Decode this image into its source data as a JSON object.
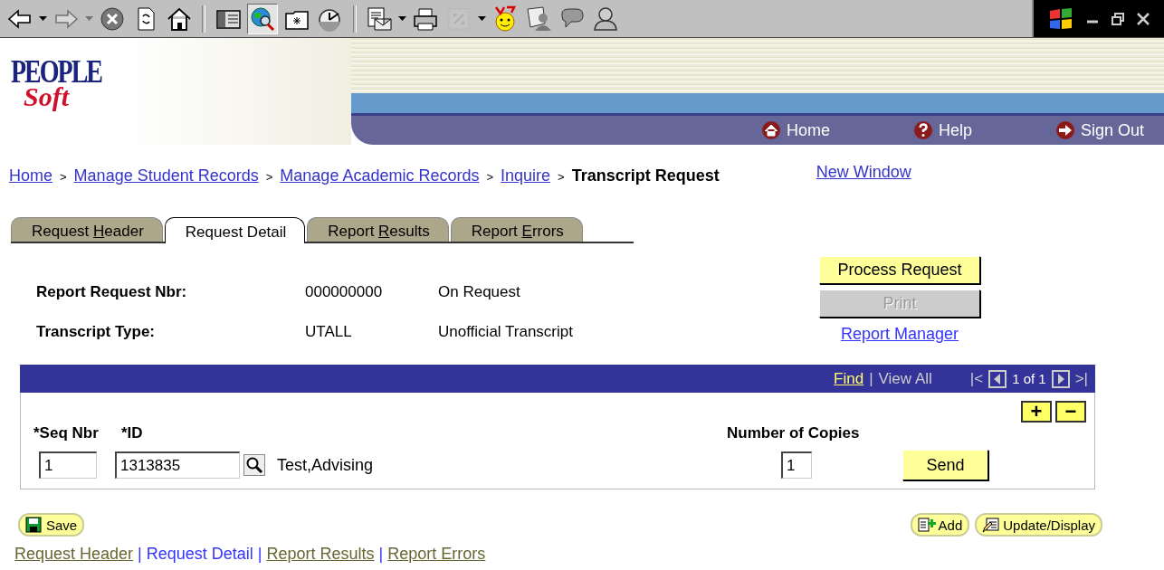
{
  "toolbar": [
    {
      "kind": "back",
      "disabled": false,
      "selected": false
    },
    {
      "kind": "dropdown",
      "disabled": false
    },
    {
      "kind": "forward",
      "disabled": true,
      "selected": false
    },
    {
      "kind": "dropdown",
      "disabled": true
    },
    {
      "kind": "stop",
      "disabled": false,
      "selected": false
    },
    {
      "kind": "refresh",
      "disabled": false,
      "selected": false
    },
    {
      "kind": "home",
      "disabled": false,
      "selected": false
    },
    {
      "kind": "separator"
    },
    {
      "kind": "panel",
      "disabled": false,
      "selected": false
    },
    {
      "kind": "search",
      "disabled": false,
      "selected": true
    },
    {
      "kind": "folder",
      "disabled": false,
      "selected": false
    },
    {
      "kind": "history",
      "disabled": false,
      "selected": false
    },
    {
      "kind": "separator"
    },
    {
      "kind": "mail",
      "disabled": false,
      "selected": false
    },
    {
      "kind": "dropdown",
      "disabled": false
    },
    {
      "kind": "print",
      "disabled": false,
      "selected": false
    },
    {
      "kind": "frame",
      "disabled": true,
      "selected": false
    },
    {
      "kind": "dropdown",
      "disabled": false
    },
    {
      "kind": "smiley",
      "disabled": false,
      "selected": false
    },
    {
      "kind": "people",
      "disabled": false,
      "selected": false
    },
    {
      "kind": "chat",
      "disabled": false,
      "selected": false
    },
    {
      "kind": "user",
      "disabled": false,
      "selected": false
    }
  ],
  "logo": {
    "top": "PEOPLE",
    "bottom": "Soft"
  },
  "header_nav": [
    {
      "kind": "home",
      "label": "Home"
    },
    {
      "kind": "help",
      "label": "Help"
    },
    {
      "kind": "signout",
      "label": "Sign Out"
    }
  ],
  "breadcrumb": [
    {
      "kind": "link",
      "text": "Home"
    },
    {
      "kind": "separator",
      "text": ">"
    },
    {
      "kind": "link",
      "text": "Manage Student Records"
    },
    {
      "kind": "separator",
      "text": ">"
    },
    {
      "kind": "link",
      "text": "Manage Academic Records"
    },
    {
      "kind": "separator",
      "text": ">"
    },
    {
      "kind": "link",
      "text": "Inquire"
    },
    {
      "kind": "separator",
      "text": ">"
    },
    {
      "kind": "current",
      "text": "Transcript Request"
    }
  ],
  "new_window": "New Window",
  "tabs": [
    {
      "parts": [
        "Request ",
        "H",
        "eader"
      ],
      "selected": false
    },
    {
      "parts": [
        "Request Detail"
      ],
      "selected": true
    },
    {
      "parts": [
        "Report ",
        "R",
        "esults"
      ],
      "selected": false
    },
    {
      "parts": [
        "Report ",
        "E",
        "rrors"
      ],
      "selected": false
    }
  ],
  "fields": [
    {
      "label": "Report Request Nbr:",
      "value": "000000000",
      "description": "On Request"
    },
    {
      "label": "Transcript Type:",
      "value": "UTALL",
      "description": "Unofficial Transcript"
    }
  ],
  "actions": [
    {
      "label": "Process Request",
      "disabled": false
    },
    {
      "label": "Print",
      "disabled": true
    }
  ],
  "report_manager": "Report Manager",
  "grid": {
    "find": "Find",
    "divider": "|",
    "view_all": "View All",
    "first": "|<",
    "counter": "1 of 1",
    "last": ">|",
    "add_row": "+",
    "delete_row": "−",
    "seq_label": "*Seq Nbr",
    "id_label": "*ID",
    "copies_label": "Number of Copies",
    "seq": "1",
    "id": "1313835",
    "name": "Test,Advising",
    "copies": "1",
    "send": "Send"
  },
  "page_buttons": [
    {
      "kind": "save",
      "label": "Save"
    },
    {
      "kind": "add",
      "label": "Add"
    },
    {
      "kind": "update",
      "label": "Update/Display"
    }
  ],
  "page_links": [
    {
      "kind": "link",
      "text": "Request Header",
      "selected": false
    },
    {
      "kind": "separator",
      "text": "|"
    },
    {
      "kind": "link",
      "text": "Request Detail",
      "selected": true
    },
    {
      "kind": "separator",
      "text": "|"
    },
    {
      "kind": "link",
      "text": "Report Results",
      "selected": false
    },
    {
      "kind": "separator",
      "text": "|"
    },
    {
      "kind": "link",
      "text": "Report Errors",
      "selected": false
    }
  ]
}
